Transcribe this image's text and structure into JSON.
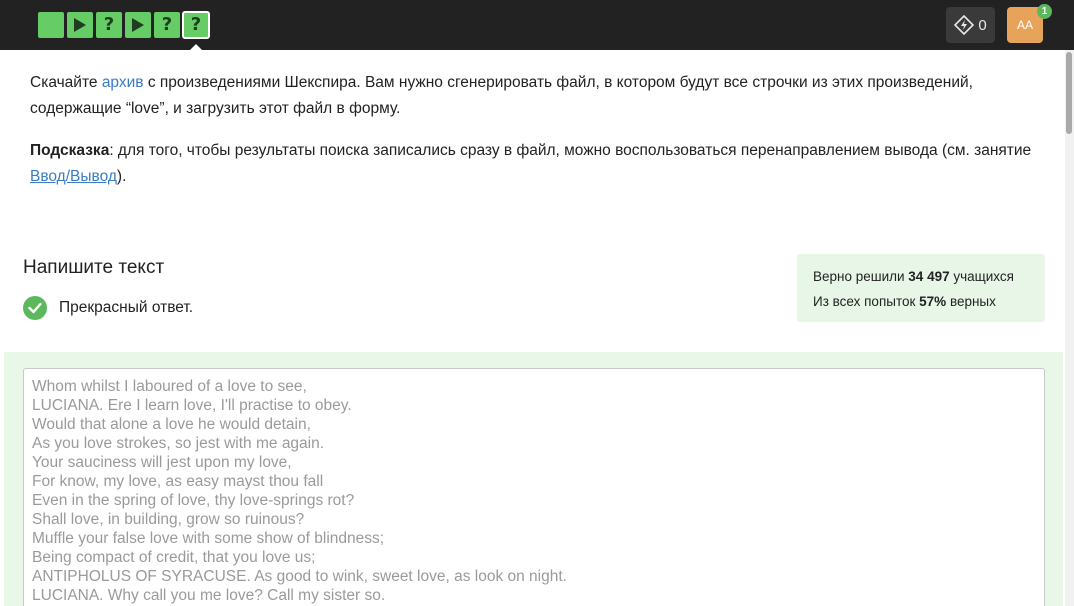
{
  "topbar": {
    "steps": [
      {
        "type": "plain"
      },
      {
        "type": "play"
      },
      {
        "type": "question",
        "label": "?"
      },
      {
        "type": "play"
      },
      {
        "type": "question",
        "label": "?"
      },
      {
        "type": "question",
        "label": "?",
        "active": true
      }
    ],
    "energy_count": "0",
    "avatar_initials": "AA",
    "notification_count": "1"
  },
  "task": {
    "p1_before_link": "Скачайте ",
    "p1_link": "архив",
    "p1_after_link": " с произведениями Шекспира. Вам нужно сгенерировать файл, в котором будут все строчки из этих произведений, содержащие “love”, и загрузить этот файл в форму.",
    "hint_label": "Подсказка",
    "hint_text": ": для того, чтобы результаты поиска записались сразу в файл, можно воспользоваться перенаправлением вывода (см. занятие ",
    "hint_link": "Ввод/Вывод",
    "hint_end": ")."
  },
  "section_title": "Напишите текст",
  "answer_status": "Прекрасный ответ.",
  "stats": {
    "line1_prefix": "Верно решили ",
    "line1_value": "34 497",
    "line1_suffix": " учащихся",
    "line2_prefix": "Из всех попыток ",
    "line2_value": "57%",
    "line2_suffix": " верных"
  },
  "answer_lines": [
    "Whom whilst I laboured of a love to see,",
    "LUCIANA. Ere I learn love, I'll practise to obey.",
    "Would that alone a love he would detain,",
    "As you love strokes, so jest with me again.",
    "Your sauciness will jest upon my love,",
    "For know, my love, as easy mayst thou fall",
    "Even in the spring of love, thy love-springs rot?",
    "Shall love, in building, grow so ruinous?",
    "Muffle your false love with some show of blindness;",
    "Being compact of credit, that you love us;",
    "ANTIPHOLUS OF SYRACUSE. As good to wink, sweet love, as look on night.",
    "LUCIANA. Why call you me love? Call my sister so."
  ],
  "colors": {
    "accent_green": "#66cc66",
    "link_blue": "#3a7cc8",
    "avatar_orange": "#e8a35a",
    "topbar_bg": "#222222"
  }
}
